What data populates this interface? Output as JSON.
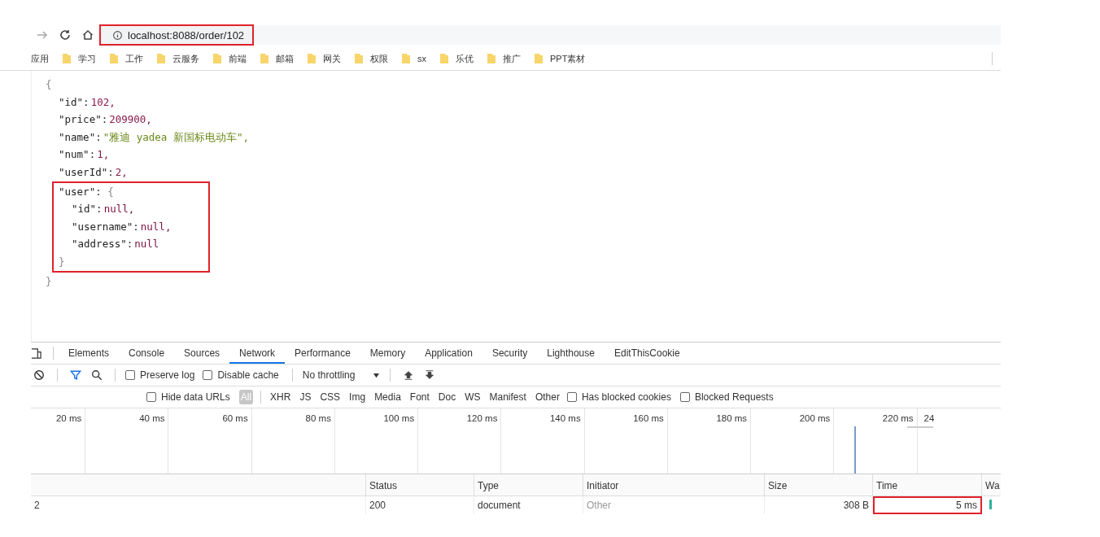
{
  "browser": {
    "url": "localhost:8088/order/102",
    "url_highlighted": true,
    "bookmarks": [
      {
        "label": "应用",
        "kind": "apps"
      },
      {
        "label": "学习",
        "kind": "folder"
      },
      {
        "label": "工作",
        "kind": "folder"
      },
      {
        "label": "云服务",
        "kind": "folder"
      },
      {
        "label": "前端",
        "kind": "folder"
      },
      {
        "label": "邮箱",
        "kind": "folder"
      },
      {
        "label": "网关",
        "kind": "folder"
      },
      {
        "label": "权限",
        "kind": "folder"
      },
      {
        "label": "sx",
        "kind": "folder"
      },
      {
        "label": "乐优",
        "kind": "folder"
      },
      {
        "label": "推广",
        "kind": "folder"
      },
      {
        "label": "PPT素材",
        "kind": "folder"
      }
    ]
  },
  "json_view": {
    "open": "{",
    "close": "}",
    "entries": [
      {
        "key": "\"id\":",
        "value": "102,",
        "kind": "number"
      },
      {
        "key": "\"price\":",
        "value": "209900,",
        "kind": "number"
      },
      {
        "key": "\"name\":",
        "value": "\"雅迪 yadea 新国标电动车\",",
        "kind": "string"
      },
      {
        "key": "\"num\":",
        "value": "1,",
        "kind": "number"
      },
      {
        "key": "\"userId\":",
        "value": "2,",
        "kind": "number"
      },
      {
        "key": "\"user\":",
        "kind": "object",
        "open": "{",
        "close": "}",
        "highlighted": true,
        "children": [
          {
            "key": "\"id\":",
            "value": "null,",
            "kind": "null"
          },
          {
            "key": "\"username\":",
            "value": "null,",
            "kind": "null"
          },
          {
            "key": "\"address\":",
            "value": "null",
            "kind": "null"
          }
        ]
      }
    ]
  },
  "devtools": {
    "tabs": [
      {
        "label": "Elements",
        "selected": false
      },
      {
        "label": "Console",
        "selected": false
      },
      {
        "label": "Sources",
        "selected": false
      },
      {
        "label": "Network",
        "selected": true
      },
      {
        "label": "Performance",
        "selected": false
      },
      {
        "label": "Memory",
        "selected": false
      },
      {
        "label": "Application",
        "selected": false
      },
      {
        "label": "Security",
        "selected": false
      },
      {
        "label": "Lighthouse",
        "selected": false
      },
      {
        "label": "EditThisCookie",
        "selected": false
      }
    ],
    "toolbar": {
      "preserve_log": {
        "label": "Preserve log",
        "checked": false
      },
      "disable_cache": {
        "label": "Disable cache",
        "checked": false
      },
      "throttling": "No throttling"
    },
    "filters": {
      "hide_data_urls": {
        "label": "Hide data URLs",
        "checked": false
      },
      "types": [
        {
          "label": "All",
          "selected": true
        },
        {
          "label": "XHR",
          "selected": false
        },
        {
          "label": "JS",
          "selected": false
        },
        {
          "label": "CSS",
          "selected": false
        },
        {
          "label": "Img",
          "selected": false
        },
        {
          "label": "Media",
          "selected": false
        },
        {
          "label": "Font",
          "selected": false
        },
        {
          "label": "Doc",
          "selected": false
        },
        {
          "label": "WS",
          "selected": false
        },
        {
          "label": "Manifest",
          "selected": false
        },
        {
          "label": "Other",
          "selected": false
        }
      ],
      "has_blocked_cookies": {
        "label": "Has blocked cookies",
        "checked": false
      },
      "blocked_requests": {
        "label": "Blocked Requests",
        "checked": false
      }
    },
    "timeline_ticks": [
      "20 ms",
      "40 ms",
      "60 ms",
      "80 ms",
      "100 ms",
      "120 ms",
      "140 ms",
      "160 ms",
      "180 ms",
      "200 ms",
      "220 ms",
      "24"
    ],
    "table": {
      "columns": [
        "",
        "Status",
        "Type",
        "Initiator",
        "Size",
        "Time",
        "Wa"
      ],
      "rows": [
        {
          "cells": [
            "2",
            "200",
            "document",
            "Other",
            "308 B",
            "5 ms"
          ],
          "time_highlighted": true
        }
      ]
    }
  }
}
